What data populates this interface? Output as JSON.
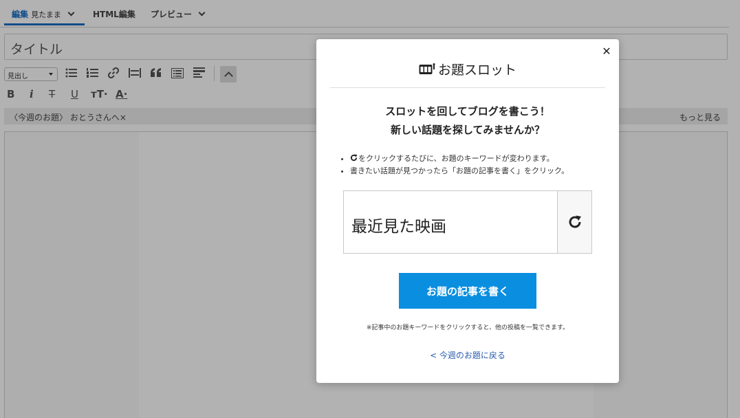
{
  "tabs": [
    {
      "label": "編集",
      "sub": "見たまま"
    },
    {
      "label": "HTML編集"
    },
    {
      "label": "プレビュー"
    }
  ],
  "editor": {
    "title_placeholder": "タイトル",
    "heading_select": "見出し",
    "topic_label": "〈今週のお題〉 おとうさんへ×",
    "more_label": "もっと見る"
  },
  "modal": {
    "title": "お題スロット",
    "lead_line1": "スロットを回してブログを書こう！",
    "lead_line2": "新しい話題を探してみませんか？",
    "note1": "をクリックするたびに、お題のキーワードが変わります。",
    "note2": "書きたい話題が見つかったら「お題の記事を書く」をクリック。",
    "slot_word": "最近見た映画",
    "write_button": "お題の記事を書く",
    "footnote": "※記事中のお題キーワードをクリックすると、他の投稿を一覧できます。",
    "back_link": "< 今週のお題に戻る"
  },
  "colors": {
    "accent_tab": "#1b6fc4",
    "button": "#0a8ee0",
    "link": "#2a5db0"
  },
  "icons": [
    "chevron-down-icon",
    "bullet-list-icon",
    "numbered-list-icon",
    "link-icon",
    "more-break-icon",
    "quote-icon",
    "table-of-contents-icon",
    "hr-icon",
    "bold-icon",
    "italic-icon",
    "strikethrough-icon",
    "underline-icon",
    "text-size-icon",
    "text-color-icon",
    "close-icon",
    "slot-icon",
    "refresh-icon"
  ]
}
